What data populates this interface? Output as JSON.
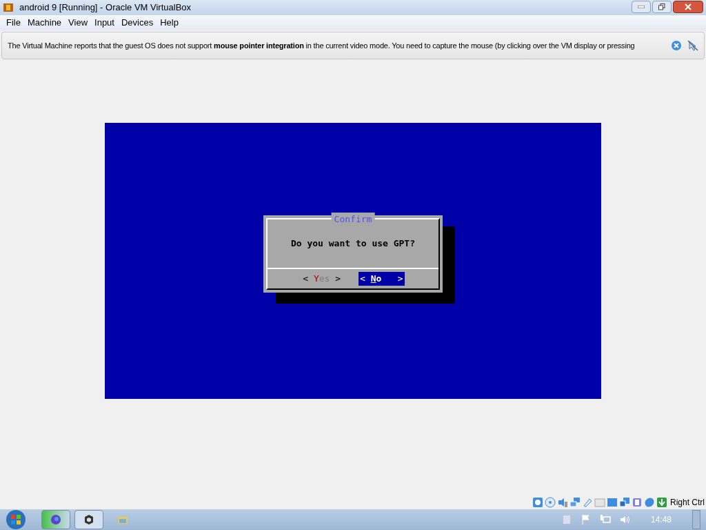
{
  "window": {
    "title": "android 9 [Running] - Oracle VM VirtualBox"
  },
  "menu": [
    "File",
    "Machine",
    "View",
    "Input",
    "Devices",
    "Help"
  ],
  "notice": {
    "text": "The Virtual Machine reports that the guest OS does not support **mouse pointer integration** in the current video mode. You need to capture the mouse (by clicking over the VM display or pressing"
  },
  "dialog": {
    "title": "Confirm",
    "message": "Do you want to use GPT?",
    "buttons": [
      {
        "left": "<",
        "hotkey": "Y",
        "rest": "es",
        "right": ">",
        "selected": false
      },
      {
        "left": "<",
        "hotkey": "N",
        "rest": "o",
        "right": ">",
        "selected": true
      }
    ]
  },
  "status_bar": {
    "host_key": "Right Ctrl"
  },
  "taskbar": {
    "clock": "14:48"
  }
}
